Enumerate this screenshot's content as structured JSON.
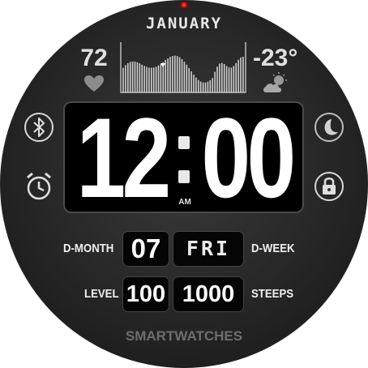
{
  "header": {
    "month": "JANUARY"
  },
  "health": {
    "heart_rate": "72"
  },
  "weather": {
    "temperature": "-23°"
  },
  "clock": {
    "hours": "12",
    "minutes": "00",
    "period": "AM"
  },
  "date_row": {
    "left_label": "D-MONTH",
    "day_of_month": "07",
    "day_of_week": "FRI",
    "right_label": "D-WEEK"
  },
  "stats_row": {
    "left_label": "LEVEL",
    "level": "100",
    "steps": "1000",
    "right_label": "STEEPS"
  },
  "brand": "SMARTWATCHES",
  "icons": [
    "heart-icon",
    "weather-partly-cloudy-icon",
    "bluetooth-icon",
    "alarm-icon",
    "moon-icon",
    "lock-icon"
  ],
  "colors": {
    "background": "#262626",
    "text": "#ffffff",
    "brand_text": "#6e6e6e",
    "indicator": "#ff3030"
  }
}
